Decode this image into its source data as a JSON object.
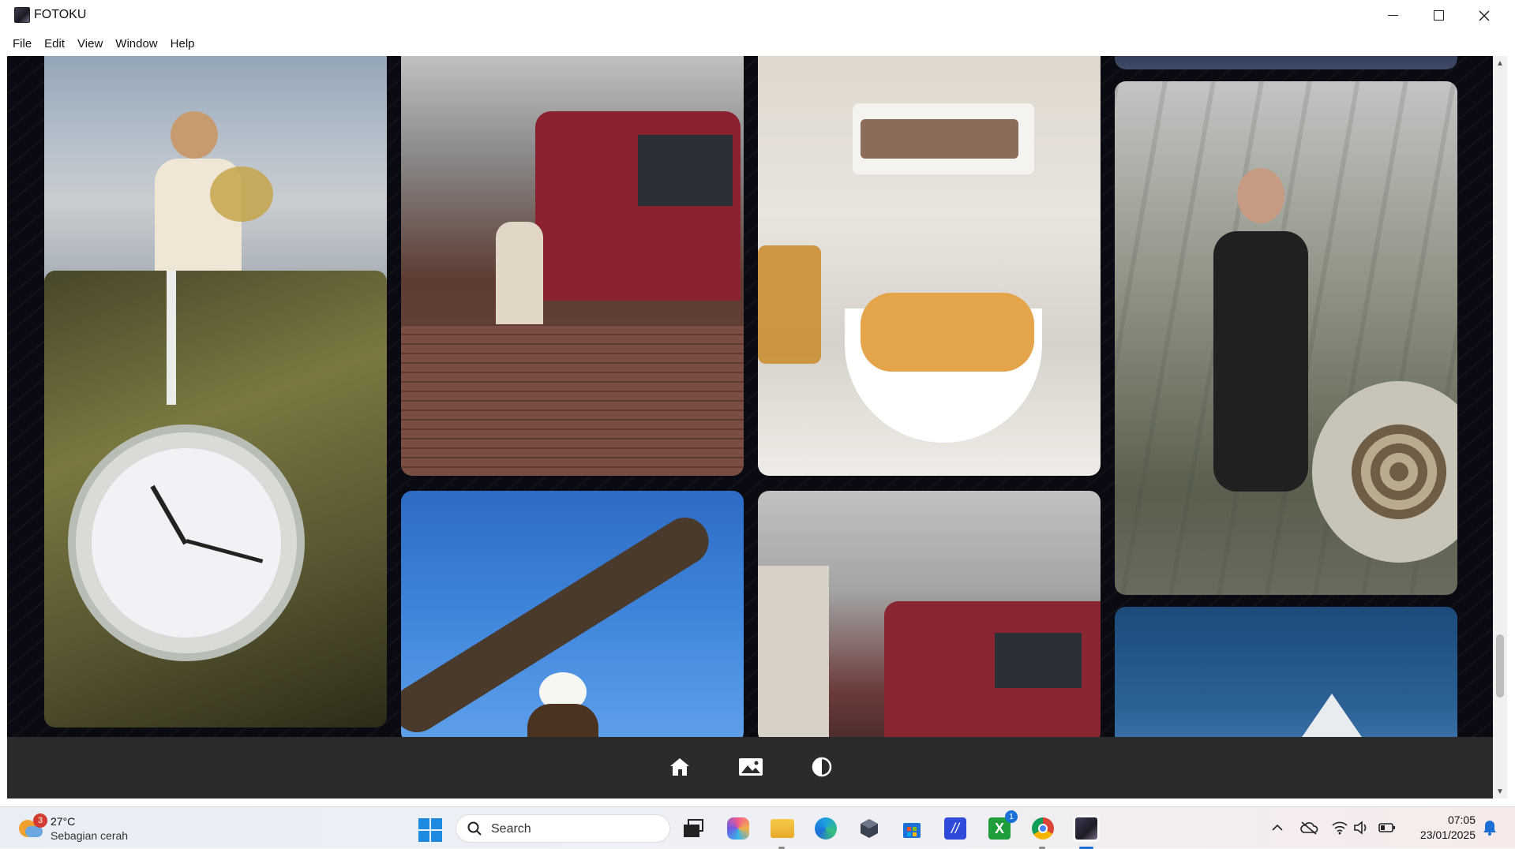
{
  "window": {
    "title": "FOTOKU",
    "menu": [
      "File",
      "Edit",
      "View",
      "Window",
      "Help"
    ]
  },
  "gallery": {
    "photos": [
      {
        "id": "man-with-flowers",
        "subject": "man holding dried flowers against sky"
      },
      {
        "id": "train-station-walk",
        "subject": "woman walking past red train on cobblestones"
      },
      {
        "id": "food-table",
        "subject": "pastries in white bowl on table"
      },
      {
        "id": "mountain-top",
        "subject": "partial landscape"
      },
      {
        "id": "station-clock",
        "subject": "hanging station clock"
      },
      {
        "id": "model-sneaker",
        "subject": "model with sunglasses and sneaker"
      },
      {
        "id": "bald-eagle",
        "subject": "bald eagle under tree branch"
      },
      {
        "id": "train-station-2",
        "subject": "red train at station with crowd"
      },
      {
        "id": "mountain-peak",
        "subject": "snowy mountain peak under blue sky"
      }
    ]
  },
  "toolbar": {
    "buttons": [
      "home-icon",
      "gallery-icon",
      "contrast-icon"
    ]
  },
  "taskbar": {
    "weather": {
      "temp": "27°C",
      "desc": "Sebagian cerah",
      "badge": "3"
    },
    "search_placeholder": "Search",
    "apps": [
      "task-view-icon",
      "copilot-icon",
      "file-explorer-icon",
      "edge-icon",
      "app-cube-icon",
      "store-icon",
      "vscode-like-icon",
      "xbox-icon",
      "chrome-icon",
      "fotoku-icon"
    ],
    "xbox_badge": "1",
    "time": "07:05",
    "date": "23/01/2025"
  }
}
